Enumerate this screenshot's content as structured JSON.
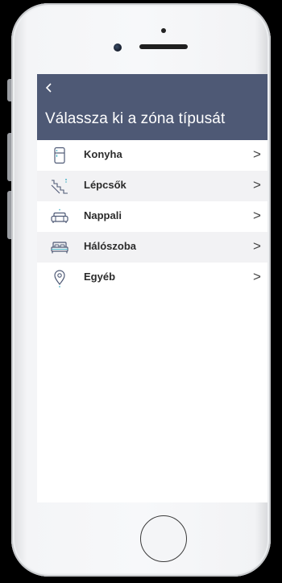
{
  "header": {
    "back_icon": "‹",
    "title": "Válassza ki a zóna típusát"
  },
  "zones": [
    {
      "label": "Konyha",
      "icon": "fridge-icon",
      "chevron": ">"
    },
    {
      "label": "Lépcsők",
      "icon": "stairs-icon",
      "chevron": ">"
    },
    {
      "label": "Nappali",
      "icon": "sofa-icon",
      "chevron": ">"
    },
    {
      "label": "Hálószoba",
      "icon": "bed-icon",
      "chevron": ">"
    },
    {
      "label": "Egyéb",
      "icon": "location-pin-icon",
      "chevron": ">"
    }
  ],
  "colors": {
    "header_bg": "#4e5975",
    "icon_stroke": "#4e5975",
    "icon_accent": "#4fb7c9",
    "row_alt_bg": "#f2f2f4"
  }
}
